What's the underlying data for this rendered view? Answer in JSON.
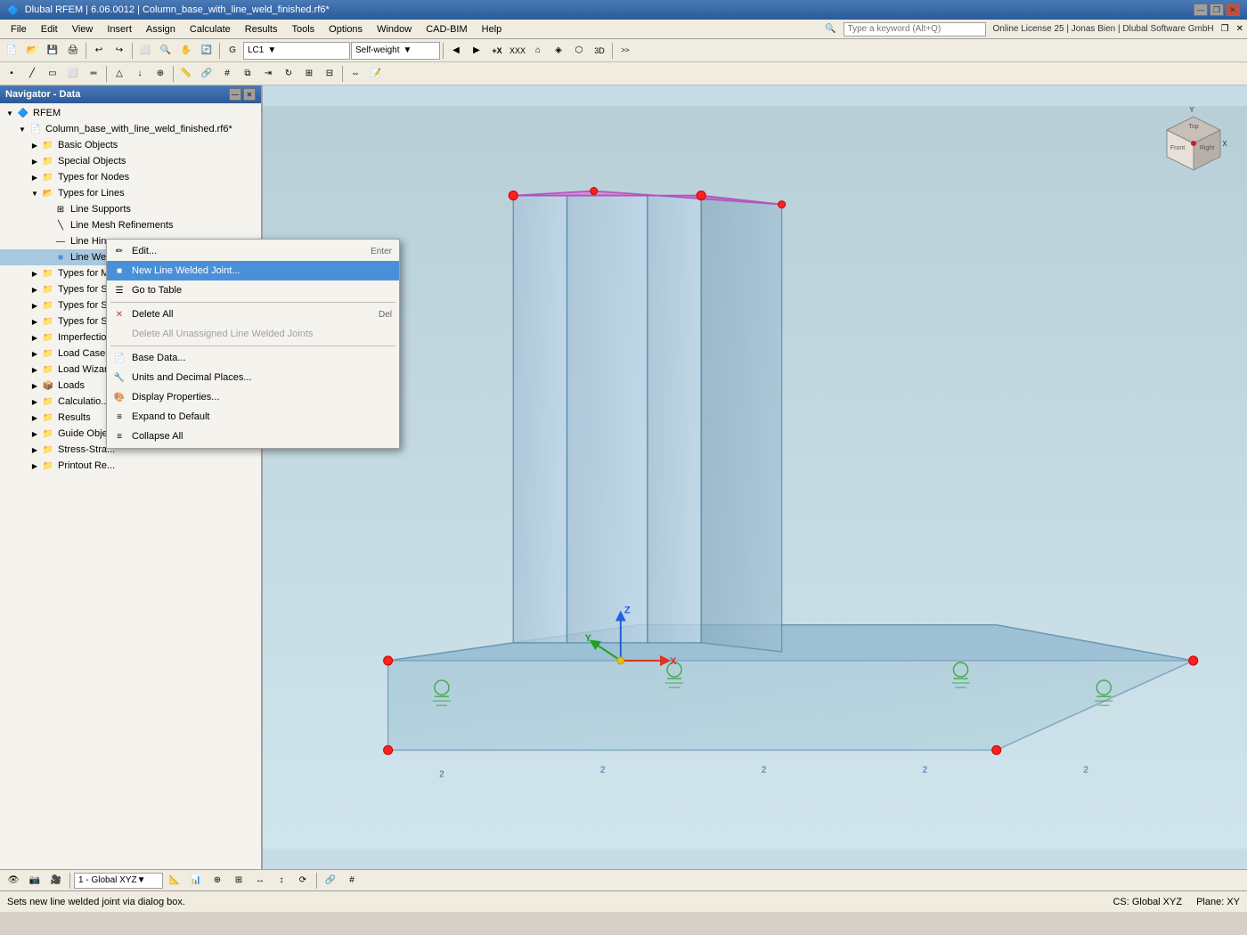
{
  "titlebar": {
    "title": "Dlubal RFEM | 6.06.0012 | Column_base_with_line_weld_finished.rf6*",
    "icon": "🔷",
    "minimize": "—",
    "maximize": "□",
    "close": "✕",
    "restore": "❐"
  },
  "menubar": {
    "items": [
      "File",
      "Edit",
      "View",
      "Insert",
      "Assign",
      "Calculate",
      "Results",
      "Tools",
      "Options",
      "Window",
      "CAD-BIM",
      "Help"
    ]
  },
  "searchbar": {
    "placeholder": "Type a keyword (Alt+Q)",
    "license_info": "Online License 25 | Jonas Bien | Dlubal Software GmbH"
  },
  "toolbar1": {
    "dropdown_label": "LC1",
    "dropdown2_label": "Self-weight"
  },
  "navigator": {
    "title": "Navigator - Data",
    "root": "RFEM",
    "file": "Column_base_with_line_weld_finished.rf6*",
    "items": [
      {
        "label": "Basic Objects",
        "level": 2,
        "expanded": false,
        "type": "folder"
      },
      {
        "label": "Special Objects",
        "level": 2,
        "expanded": false,
        "type": "folder"
      },
      {
        "label": "Types for Nodes",
        "level": 2,
        "expanded": false,
        "type": "folder"
      },
      {
        "label": "Types for Lines",
        "level": 2,
        "expanded": true,
        "type": "folder"
      },
      {
        "label": "Line Supports",
        "level": 3,
        "expanded": false,
        "type": "item"
      },
      {
        "label": "Line Mesh Refinements",
        "level": 3,
        "expanded": false,
        "type": "item"
      },
      {
        "label": "Line Hinges",
        "level": 3,
        "expanded": false,
        "type": "item"
      },
      {
        "label": "Line Welded Joints",
        "level": 3,
        "expanded": false,
        "type": "item",
        "selected": true
      },
      {
        "label": "Types for M...",
        "level": 2,
        "expanded": false,
        "type": "folder"
      },
      {
        "label": "Types for S...",
        "level": 2,
        "expanded": false,
        "type": "folder"
      },
      {
        "label": "Types for S...",
        "level": 2,
        "expanded": false,
        "type": "folder"
      },
      {
        "label": "Types for S...",
        "level": 2,
        "expanded": false,
        "type": "folder"
      },
      {
        "label": "Imperfectio...",
        "level": 2,
        "expanded": false,
        "type": "folder"
      },
      {
        "label": "Load Cases",
        "level": 2,
        "expanded": false,
        "type": "folder"
      },
      {
        "label": "Load Wizar...",
        "level": 2,
        "expanded": false,
        "type": "folder"
      },
      {
        "label": "Loads",
        "level": 2,
        "expanded": false,
        "type": "folder"
      },
      {
        "label": "Calculatio...",
        "level": 2,
        "expanded": false,
        "type": "folder"
      },
      {
        "label": "Results",
        "level": 2,
        "expanded": false,
        "type": "folder"
      },
      {
        "label": "Guide Obje...",
        "level": 2,
        "expanded": false,
        "type": "folder"
      },
      {
        "label": "Stress-Stra...",
        "level": 2,
        "expanded": false,
        "type": "folder"
      },
      {
        "label": "Printout Re...",
        "level": 2,
        "expanded": false,
        "type": "folder"
      }
    ]
  },
  "context_menu": {
    "items": [
      {
        "label": "Edit...",
        "shortcut": "Enter",
        "icon": "✏️",
        "type": "normal"
      },
      {
        "label": "New Line Welded Joint...",
        "shortcut": "",
        "icon": "🔷",
        "type": "highlight"
      },
      {
        "label": "Go to Table",
        "shortcut": "",
        "icon": "📋",
        "type": "normal"
      },
      {
        "type": "separator"
      },
      {
        "label": "Delete All",
        "shortcut": "Del",
        "icon": "✕",
        "type": "normal"
      },
      {
        "label": "Delete All Unassigned Line Welded Joints",
        "shortcut": "",
        "icon": "",
        "type": "disabled"
      },
      {
        "type": "separator"
      },
      {
        "label": "Base Data...",
        "shortcut": "",
        "icon": "📄",
        "type": "normal"
      },
      {
        "label": "Units and Decimal Places...",
        "shortcut": "",
        "icon": "🔧",
        "type": "normal"
      },
      {
        "label": "Display Properties...",
        "shortcut": "",
        "icon": "🎨",
        "type": "normal"
      },
      {
        "label": "Expand to Default",
        "shortcut": "",
        "icon": "≡",
        "type": "normal"
      },
      {
        "label": "Collapse All",
        "shortcut": "",
        "icon": "≡",
        "type": "normal"
      }
    ]
  },
  "viewport": {
    "background_color": "#c8dce8",
    "coordinate_system": "CS: Global XYZ",
    "plane": "Plane: XY"
  },
  "statusbar": {
    "left_text": "Sets new line welded joint via dialog box.",
    "coord_system": "CS: Global XYZ",
    "plane": "Plane: XY"
  },
  "bottom_toolbar": {
    "dropdown_label": "1 - Global XYZ"
  },
  "axes": {
    "x_color": "#ff0000",
    "y_color": "#00cc00",
    "z_color": "#0000ff"
  }
}
